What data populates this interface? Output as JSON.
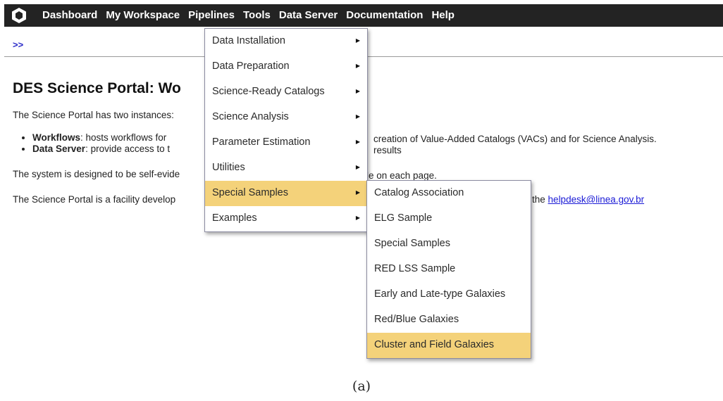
{
  "navbar": {
    "items": [
      "Dashboard",
      "My Workspace",
      "Pipelines",
      "Tools",
      "Data Server",
      "Documentation",
      "Help"
    ]
  },
  "breadcrumb": ">>",
  "page": {
    "title": "DES Science Portal: Wo",
    "intro": "The Science Portal has two instances:",
    "bullets": [
      {
        "term": "Workflows",
        "text": ": hosts workflows for"
      },
      {
        "term": "Data Server",
        "text": ": provide access to t"
      }
    ],
    "bullet1_tail": "creation of Value-Added Catalogs (VACs) and for Science Analysis.",
    "bullet2_tail": "results",
    "system_line": "The system is designed to be self-evide",
    "system_tail": "le on each page.",
    "facility_line": "The Science Portal is a facility develop",
    "facility_tail": "the",
    "email": "helpdesk@linea.gov.br"
  },
  "pipelines_menu": {
    "items": [
      "Data Installation",
      "Data Preparation",
      "Science-Ready Catalogs",
      "Science Analysis",
      "Parameter Estimation",
      "Utilities",
      "Special Samples",
      "Examples"
    ],
    "highlighted": "Special Samples"
  },
  "special_samples_menu": {
    "items": [
      "Catalog Association",
      "ELG Sample",
      "Special Samples",
      "RED LSS Sample",
      "Early and Late-type Galaxies",
      "Red/Blue Galaxies",
      "Cluster and Field Galaxies"
    ],
    "highlighted": "Cluster and Field Galaxies"
  },
  "caption": "(a)",
  "colors": {
    "navbar": "#232323",
    "highlight": "#f4d27a",
    "link": "#1a1ad6"
  },
  "icons": {
    "logo": "portal-logo-icon",
    "submenu": "triangle-right-icon"
  }
}
